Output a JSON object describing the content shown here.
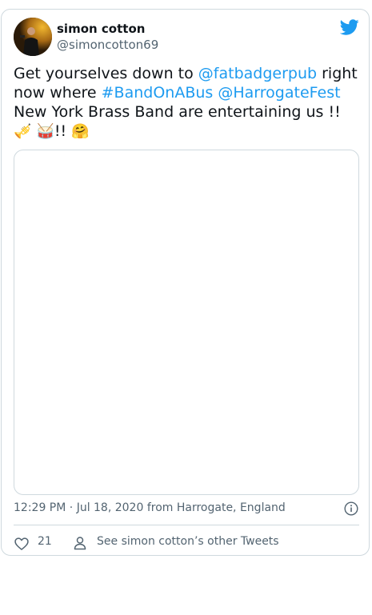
{
  "tweet": {
    "author_name": "simon cotton",
    "author_handle": "@simoncotton69",
    "text": {
      "line1_prefix": "Get yourselves down to ",
      "mention_pub": "@fatbadgerpub",
      "line1_suffix": " right",
      "line2_prefix": "now where ",
      "hashtag": "#BandOnABus",
      "line2_space": " ",
      "mention_fest": "@HarrogateFest",
      "line3": "New York Brass Band are entertaining us !!",
      "emoji_trumpet": "🎺",
      "emoji_drum": "🥁",
      "line4_bang": "!! ",
      "emoji_hug": "🤗"
    },
    "time": "12:29 PM",
    "separator": " · ",
    "date": "Jul 18, 2020",
    "from_word": " from ",
    "location": "Harrogate, England",
    "like_count": "21",
    "other_tweets_label": "See simon cotton’s other Tweets"
  },
  "colors": {
    "link": "#1d9bf0",
    "border": "#cfd9de",
    "muted": "#536471",
    "text": "#0f1419"
  },
  "icons": {
    "brand": "twitter-bird-icon",
    "info": "info-icon",
    "like": "heart-icon",
    "profile": "person-icon"
  }
}
